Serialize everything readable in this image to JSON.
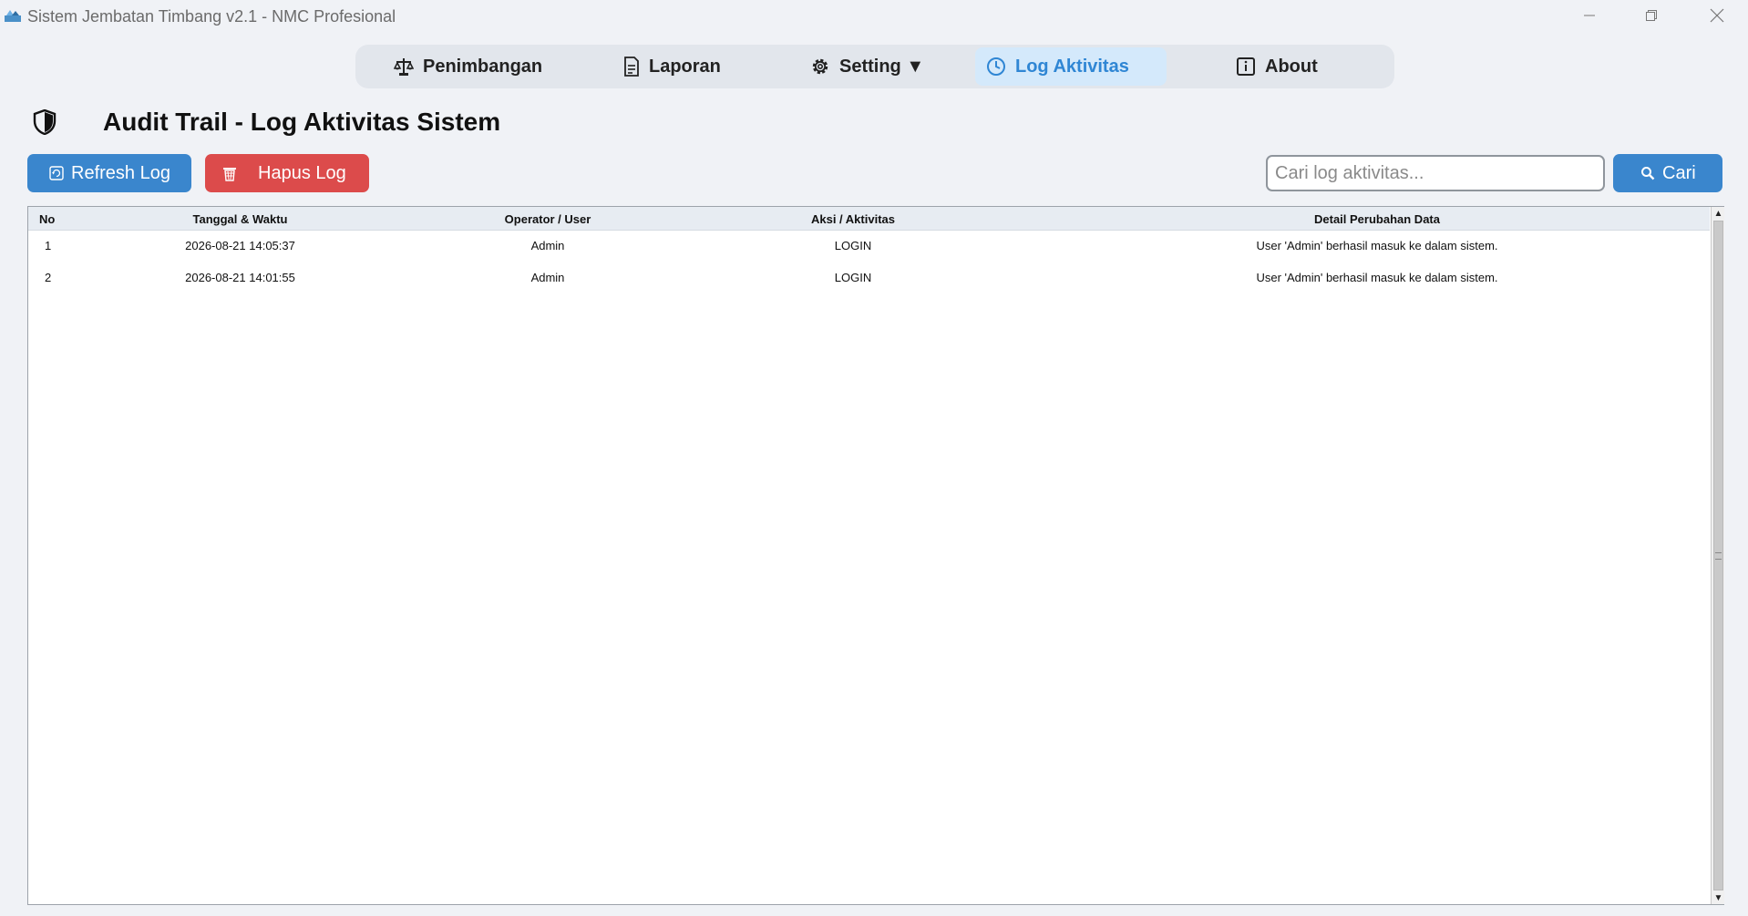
{
  "window": {
    "title": "Sistem Jembatan Timbang v2.1 - NMC Profesional",
    "minimize_glyph": "—",
    "maximize_glyph": "❐",
    "close_glyph": "✕"
  },
  "nav": {
    "items": [
      {
        "label": "Penimbangan",
        "icon": "scale-icon"
      },
      {
        "label": "Laporan",
        "icon": "document-icon"
      },
      {
        "label": "Setting ▼",
        "icon": "gear-icon"
      },
      {
        "label": "Log Aktivitas",
        "icon": "clock-icon",
        "active": true
      },
      {
        "label": "About",
        "icon": "info-icon"
      }
    ]
  },
  "page": {
    "title": "Audit Trail - Log Aktivitas Sistem",
    "icon": "shield-icon"
  },
  "toolbar": {
    "refresh_label": "Refresh Log",
    "hapus_label": "Hapus Log",
    "search_placeholder": "Cari log aktivitas...",
    "search_value": "",
    "cari_label": "Cari"
  },
  "table": {
    "headers": [
      "No",
      "Tanggal & Waktu",
      "Operator / User",
      "Aksi / Aktivitas",
      "Detail Perubahan Data"
    ],
    "rows": [
      [
        "1",
        "2026-08-21 14:05:37",
        "Admin",
        "LOGIN",
        "User 'Admin' berhasil masuk ke dalam sistem."
      ],
      [
        "2",
        "2026-08-21 14:01:55",
        "Admin",
        "LOGIN",
        "User 'Admin' berhasil masuk ke dalam sistem."
      ]
    ]
  },
  "colors": {
    "accent": "#3a86cd",
    "danger": "#dc4b4b",
    "active_tab_bg": "#d4e9fb",
    "active_tab_text": "#2f86d4"
  }
}
